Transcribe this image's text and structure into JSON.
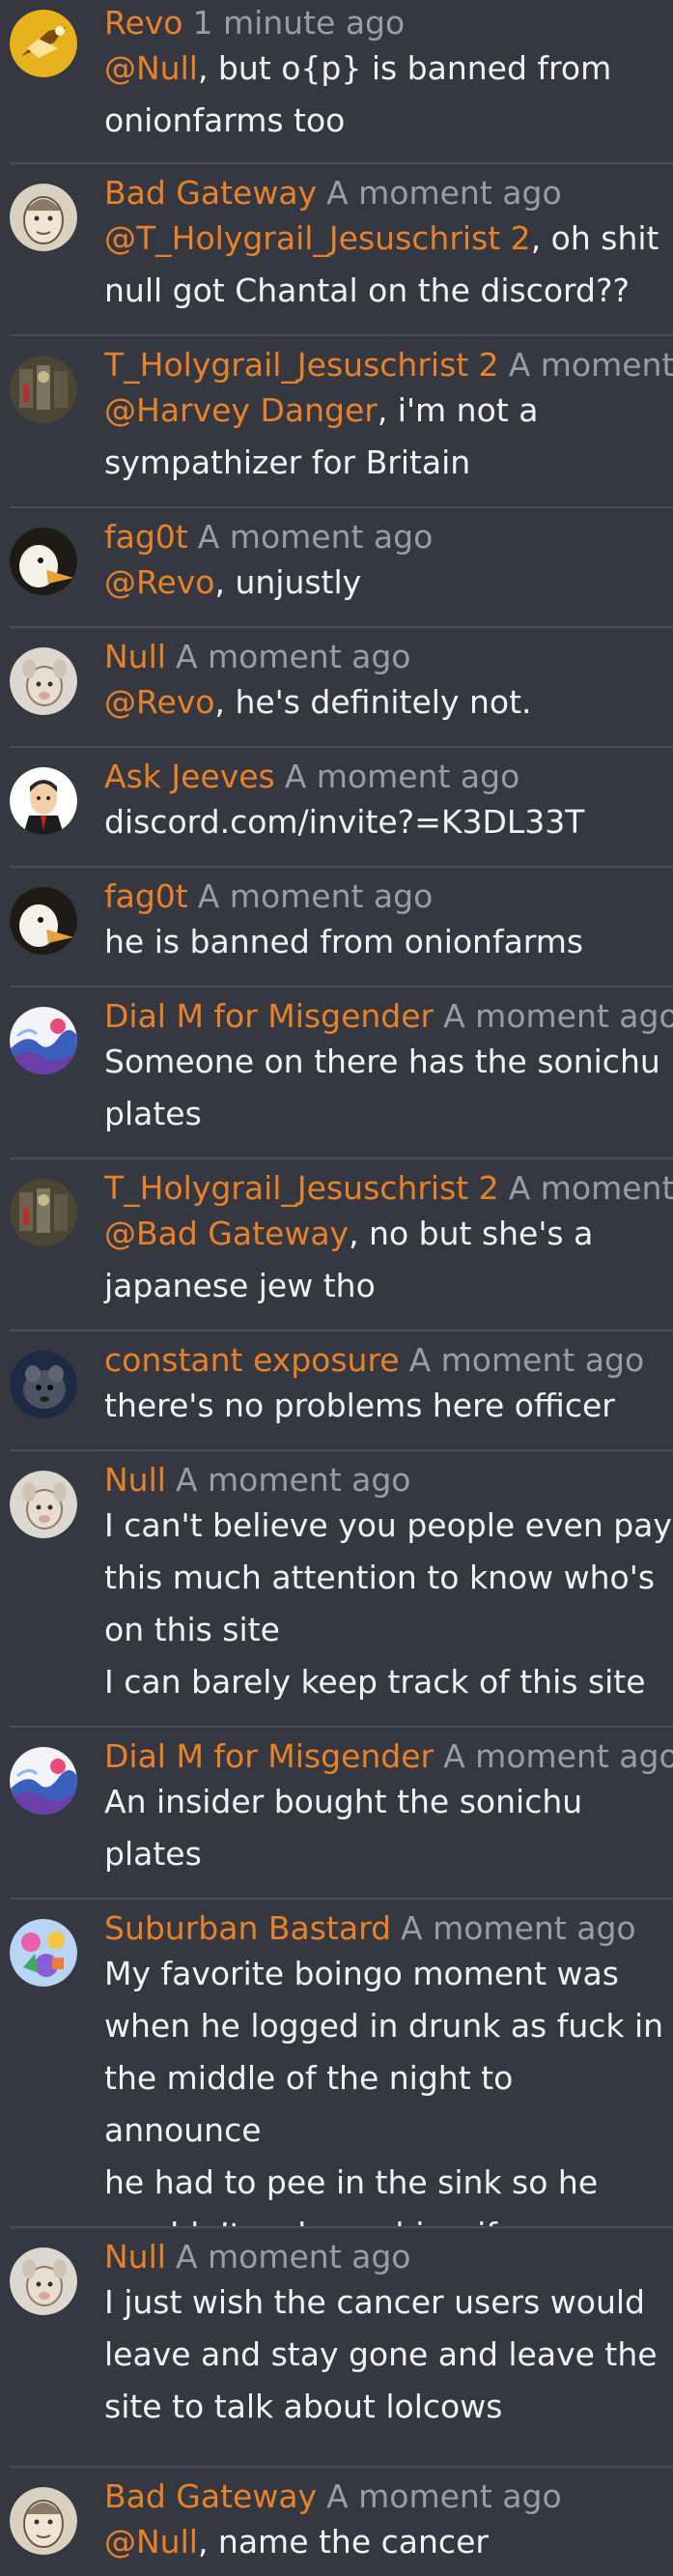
{
  "messages": [
    {
      "author": "Revo",
      "time": "1 minute ago",
      "mention": "@Null",
      "lines": [
        ", but o{p} is banned from",
        "onionfarms too"
      ],
      "avatar": "revo-avatar"
    },
    {
      "author": "Bad Gateway",
      "time": "A moment ago",
      "mention": "@T_Holygrail_Jesuschrist 2",
      "lines": [
        ", oh shit",
        "null got Chantal on the discord??"
      ],
      "avatar": "bad-gateway-avatar"
    },
    {
      "author": "T_Holygrail_Jesuschrist 2",
      "time": "A moment ago",
      "mention": "@Harvey Danger",
      "lines": [
        ", i'm not a",
        "sympathizer for Britain"
      ],
      "avatar": "holygrail-avatar"
    },
    {
      "author": "fag0t",
      "time": "A moment ago",
      "mention": "@Revo",
      "lines": [
        ", unjustly"
      ],
      "avatar": "duck-avatar"
    },
    {
      "author": "Null",
      "time": "A moment ago",
      "mention": "@Revo",
      "lines": [
        ", he's definitely not."
      ],
      "avatar": "null-avatar"
    },
    {
      "author": "Ask Jeeves",
      "time": "A moment ago",
      "mention": "",
      "lines": [
        "discord.com/invite?=K3DL33T"
      ],
      "avatar": "jeeves-avatar"
    },
    {
      "author": "fag0t",
      "time": "A moment ago",
      "mention": "",
      "lines": [
        "he is banned from onionfarms"
      ],
      "avatar": "duck-avatar"
    },
    {
      "author": "Dial M for Misgender",
      "time": "A moment ago",
      "mention": "",
      "lines": [
        "Someone on there has the sonichu",
        "plates"
      ],
      "avatar": "wave-avatar"
    },
    {
      "author": "T_Holygrail_Jesuschrist 2",
      "time": "A moment ago",
      "mention": "@Bad Gateway",
      "lines": [
        ", no but she's a",
        "japanese jew tho"
      ],
      "avatar": "holygrail-avatar"
    },
    {
      "author": "constant exposure",
      "time": "A moment ago",
      "mention": "",
      "lines": [
        "there's no problems here officer"
      ],
      "avatar": "exposure-avatar"
    },
    {
      "author": "Null",
      "time": "A moment ago",
      "mention": "",
      "lines": [
        "I can't believe you people even pay",
        "this much attention to know who's",
        "on this site",
        "I can barely keep track of this site"
      ],
      "avatar": "null-avatar"
    },
    {
      "author": "Dial M for Misgender",
      "time": "A moment ago",
      "mention": "",
      "lines": [
        "An insider bought the sonichu",
        "plates"
      ],
      "avatar": "wave-avatar"
    },
    {
      "author": "Suburban Bastard",
      "time": "A moment ago",
      "mention": "",
      "lines": [
        "My favorite boingo moment was",
        "when he logged in drunk as fuck in",
        "the middle of the night to announce",
        "he had to pee in the sink so he",
        "wouldn’t wake up his wife"
      ],
      "avatar": "suburban-avatar"
    },
    {
      "author": "Null",
      "time": "A moment ago",
      "mention": "",
      "lines": [
        "I just wish the cancer users would",
        "leave and stay gone and leave the",
        "site to talk about lolcows"
      ],
      "avatar": "null-avatar"
    },
    {
      "author": "Bad Gateway",
      "time": "A moment ago",
      "mention": "@Null",
      "lines": [
        ", name the cancer"
      ],
      "avatar": "bad-gateway-avatar"
    }
  ],
  "colors": {
    "background": "#353840",
    "author": "#e8822a",
    "mention": "#e8822a",
    "timestamp": "#9a9da5",
    "text": "#f2f2f2",
    "divider": "#4a4d55"
  }
}
